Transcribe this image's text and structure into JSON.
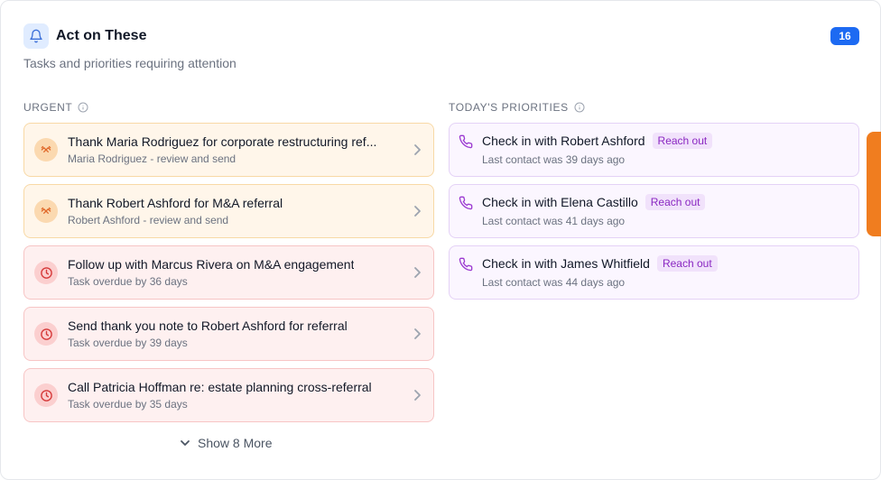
{
  "header": {
    "title": "Act on These",
    "subtitle": "Tasks and priorities requiring attention",
    "count": "16",
    "icon": "bell-icon"
  },
  "urgent": {
    "label": "URGENT",
    "items": [
      {
        "title": "Thank Maria Rodriguez for corporate restructuring ref...",
        "subtitle": "Maria Rodriguez - review and send",
        "icon": "handshake-icon",
        "tone": "orange"
      },
      {
        "title": "Thank Robert Ashford for M&A referral",
        "subtitle": "Robert Ashford - review and send",
        "icon": "handshake-icon",
        "tone": "orange"
      },
      {
        "title": "Follow up with Marcus Rivera on M&A engagement",
        "subtitle": "Task overdue by 36 days",
        "icon": "clock-icon",
        "tone": "red"
      },
      {
        "title": "Send thank you note to Robert Ashford for referral",
        "subtitle": "Task overdue by 39 days",
        "icon": "clock-icon",
        "tone": "red"
      },
      {
        "title": "Call Patricia Hoffman re: estate planning cross-referral",
        "subtitle": "Task overdue by 35 days",
        "icon": "clock-icon",
        "tone": "red"
      }
    ],
    "show_more": "Show 8 More"
  },
  "priorities": {
    "label": "TODAY'S PRIORITIES",
    "items": [
      {
        "title": "Check in with Robert Ashford",
        "badge": "Reach out",
        "subtitle": "Last contact was 39 days ago",
        "icon": "phone-icon"
      },
      {
        "title": "Check in with Elena Castillo",
        "badge": "Reach out",
        "subtitle": "Last contact was 41 days ago",
        "icon": "phone-icon"
      },
      {
        "title": "Check in with James Whitfield",
        "badge": "Reach out",
        "subtitle": "Last contact was 44 days ago",
        "icon": "phone-icon"
      }
    ]
  },
  "colors": {
    "accent": "#1d6af2",
    "urgent_orange": "#fff6ea",
    "urgent_red": "#fef0f0",
    "priority_purple": "#fbf6ff",
    "badge_purple": "#8a27c2",
    "edge_tab": "#f07d1f"
  }
}
